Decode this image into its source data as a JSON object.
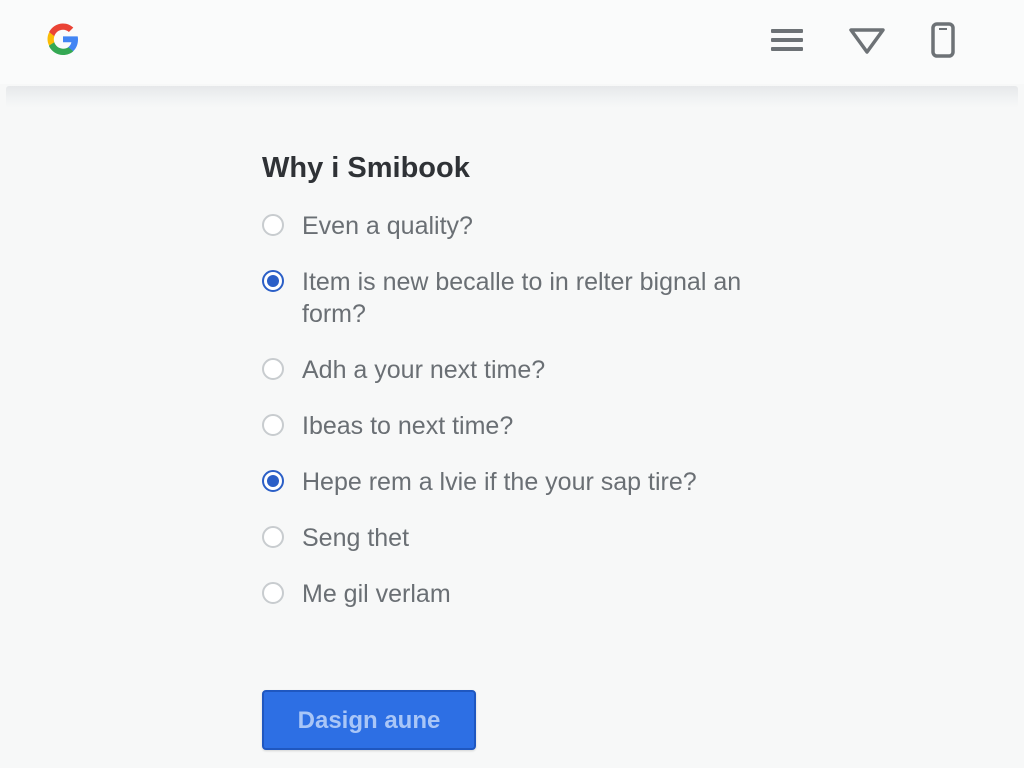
{
  "header": {
    "logo_letter": "G",
    "icons": [
      "menu-icon",
      "filter-icon",
      "phone-icon"
    ]
  },
  "main": {
    "heading": "Why i Smibook",
    "options": [
      {
        "label": "Even a quality?",
        "checked": false
      },
      {
        "label": "Item is new becalle to in relter bignal an form?",
        "checked": true
      },
      {
        "label": "Adh a your next time?",
        "checked": false
      },
      {
        "label": "Ibeas to next time?",
        "checked": false
      },
      {
        "label": "Hepe rem a lvie if the your sap tire?",
        "checked": true
      },
      {
        "label": "Seng thet",
        "checked": false
      },
      {
        "label": "Me gil verlam",
        "checked": false
      }
    ],
    "submit_label": "Dasign aune"
  },
  "colors": {
    "accent": "#2d6fe4",
    "radio_checked": "#2b5fc7",
    "background": "#f7f8f8"
  }
}
